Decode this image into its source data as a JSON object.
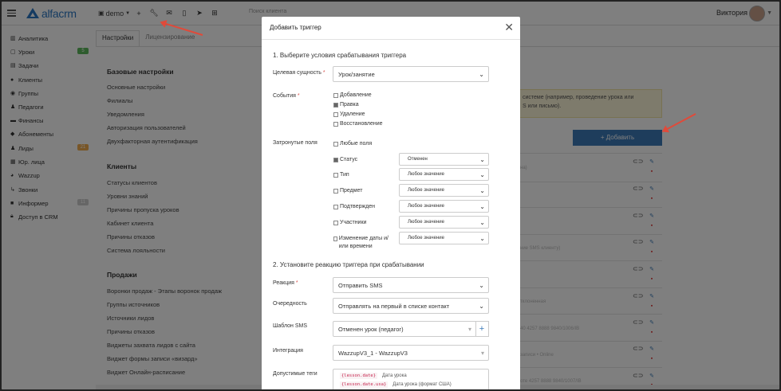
{
  "app": {
    "name": "alfacrm"
  },
  "topbar": {
    "account_label": "demo",
    "search_placeholder": "Поиск клиента",
    "user_name": "Виктория",
    "icons": [
      "add-icon",
      "wrench-icon",
      "mail-icon",
      "phone-icon",
      "telegram-icon",
      "cart-icon"
    ]
  },
  "sidebar": {
    "items": [
      {
        "label": "Аналитика",
        "icon": "chart-icon"
      },
      {
        "label": "Уроки",
        "icon": "calendar-icon",
        "badge": "5",
        "badge_color": "#5cb85c"
      },
      {
        "label": "Задачи",
        "icon": "tasks-icon"
      },
      {
        "label": "Клиенты",
        "icon": "user-icon"
      },
      {
        "label": "Группы",
        "icon": "group-icon"
      },
      {
        "label": "Педагоги",
        "icon": "teacher-icon"
      },
      {
        "label": "Финансы",
        "icon": "money-icon"
      },
      {
        "label": "Абонементы",
        "icon": "tag-icon"
      },
      {
        "label": "Лиды",
        "icon": "leads-icon",
        "badge": "21",
        "badge_color": "#f0ad4e"
      },
      {
        "label": "Юр. лица",
        "icon": "building-icon"
      },
      {
        "label": "Wazzup",
        "icon": "whatsapp-icon"
      },
      {
        "label": "Звонки",
        "icon": "call-icon"
      },
      {
        "label": "Информер",
        "icon": "informer-icon",
        "badge": "11",
        "badge_color": "#cccccc"
      },
      {
        "label": "Доступ в CRM",
        "icon": "lock-icon"
      }
    ]
  },
  "settings": {
    "tabs": [
      "Настройки",
      "Лицензирование"
    ],
    "sections": [
      {
        "title": "Базовые настройки",
        "links": [
          "Основные настройки",
          "Филиалы",
          "Уведомления",
          "Авторизация пользователей",
          "Двухфакторная аутентификация"
        ]
      },
      {
        "title": "Клиенты",
        "links": [
          "Статусы клиентов",
          "Уровни знаний",
          "Причины пропуска уроков",
          "Кабинет клиента",
          "Причины отказов",
          "Система лояльности"
        ]
      },
      {
        "title": "Продажи",
        "links": [
          "Воронки продаж - Этапы воронок продаж",
          "Группы источников",
          "Источники лидов",
          "Причины отказов",
          "Виджеты захвата лидов с сайта",
          "Виджет формы записи «визард»",
          "Виджет Онлайн-расписание"
        ]
      }
    ],
    "notice": "системе (например, проведение урока или\nS или письмо).",
    "add_button": "+ Добавить",
    "rows": [
      "на)",
      "",
      "ние SMS клиенту)",
      "",
      "тклоненная",
      "",
      "40 4257 8888 9840/1006/IB",
      "",
      "записи • Online",
      "",
      "оте 4257 8888 9840/1007/IB"
    ]
  },
  "modal": {
    "title": "Добавить триггер",
    "step1": "1. Выберите условия срабатывания триггера",
    "target_label": "Целевая сущность",
    "target_value": "Урок/занятие",
    "events_label": "События",
    "events": [
      {
        "label": "Добавление",
        "checked": false
      },
      {
        "label": "Правка",
        "checked": true
      },
      {
        "label": "Удаление",
        "checked": false
      },
      {
        "label": "Восстановление",
        "checked": false
      }
    ],
    "fields_label": "Затронутые поля",
    "any_fields": "Любые поля",
    "fields": [
      {
        "label": "Статус",
        "checked": true,
        "value": "Отменен"
      },
      {
        "label": "Тип",
        "checked": false,
        "value": "Любое значение"
      },
      {
        "label": "Предмет",
        "checked": false,
        "value": "Любое значение"
      },
      {
        "label": "Подтвержден",
        "checked": false,
        "value": "Любое значение"
      },
      {
        "label": "Участники",
        "checked": false,
        "value": "Любое значение"
      },
      {
        "label": "Изменение даты и/ или времени",
        "checked": false,
        "value": "Любое значение"
      }
    ],
    "step2": "2. Установите реакцию триггера при срабатывании",
    "reaction_label": "Реакция",
    "reaction_value": "Отправить SMS",
    "order_label": "Очередность",
    "order_value": "Отправлять на первый в списке контакт",
    "template_label": "Шаблон SMS",
    "template_value": "Отменен урок (педагог)",
    "integration_label": "Интеграция",
    "integration_value": "WazzupV3_1 - WazzupV3",
    "tags_label": "Допустимые теги",
    "tags": [
      {
        "code": "{lesson.date}",
        "desc": "Дата урока"
      },
      {
        "code": "{lesson.date.usa}",
        "desc": "Дата урока (формат США)"
      }
    ]
  },
  "colors": {
    "accent": "#2b77c3",
    "button": "#3d7bb8",
    "arrow": "#e04a3a",
    "required": "#d9534f"
  }
}
